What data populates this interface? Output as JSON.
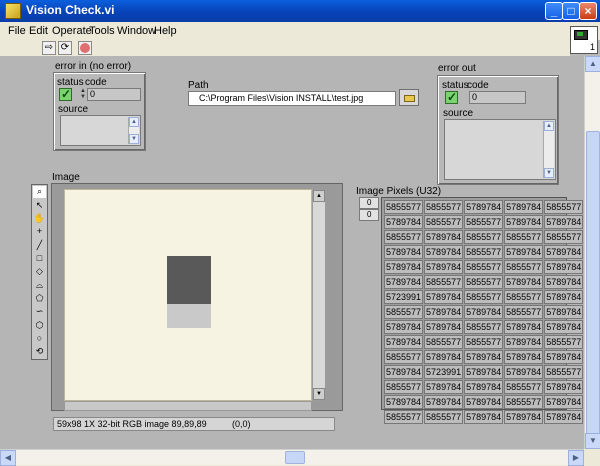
{
  "window": {
    "title": "Vision Check.vi"
  },
  "menu": [
    "File",
    "Edit",
    "Operate",
    "Tools",
    "Window",
    "Help"
  ],
  "vi_icon": {
    "number": "1"
  },
  "error_in": {
    "label": "error in (no error)",
    "status_label": "status",
    "code_label": "code",
    "code_value": "0",
    "source_label": "source"
  },
  "error_out": {
    "label": "error out",
    "status_label": "status",
    "code_label": "code",
    "code_value": "0",
    "source_label": "source"
  },
  "path": {
    "label": "Path",
    "value": "C:\\Program Files\\Vision INSTALL\\test.jpg"
  },
  "image": {
    "label": "Image",
    "status_info": "59x98 1X 32-bit RGB image 89,89,89",
    "status_coords": "(0,0)"
  },
  "pixels": {
    "label": "Image Pixels (U32)",
    "row_index": "0",
    "col_index": "0",
    "rows": [
      [
        "5855577",
        "5855577",
        "5789784",
        "5789784",
        "5855577"
      ],
      [
        "5789784",
        "5855577",
        "5855577",
        "5789784",
        "5789784"
      ],
      [
        "5855577",
        "5789784",
        "5855577",
        "5855577",
        "5855577"
      ],
      [
        "5789784",
        "5789784",
        "5855577",
        "5789784",
        "5789784"
      ],
      [
        "5789784",
        "5789784",
        "5855577",
        "5855577",
        "5789784"
      ],
      [
        "5789784",
        "5855577",
        "5855577",
        "5789784",
        "5789784"
      ],
      [
        "5723991",
        "5789784",
        "5855577",
        "5855577",
        "5789784"
      ],
      [
        "5855577",
        "5789784",
        "5789784",
        "5855577",
        "5789784"
      ],
      [
        "5789784",
        "5789784",
        "5855577",
        "5789784",
        "5789784"
      ],
      [
        "5789784",
        "5855577",
        "5855577",
        "5789784",
        "5855577"
      ],
      [
        "5855577",
        "5789784",
        "5789784",
        "5789784",
        "5789784"
      ],
      [
        "5789784",
        "5723991",
        "5789784",
        "5789784",
        "5855577"
      ],
      [
        "5855577",
        "5789784",
        "5789784",
        "5855577",
        "5789784"
      ],
      [
        "5789784",
        "5789784",
        "5789784",
        "5855577",
        "5789784"
      ],
      [
        "5855577",
        "5855577",
        "5789784",
        "5789784",
        "5789784"
      ]
    ]
  }
}
